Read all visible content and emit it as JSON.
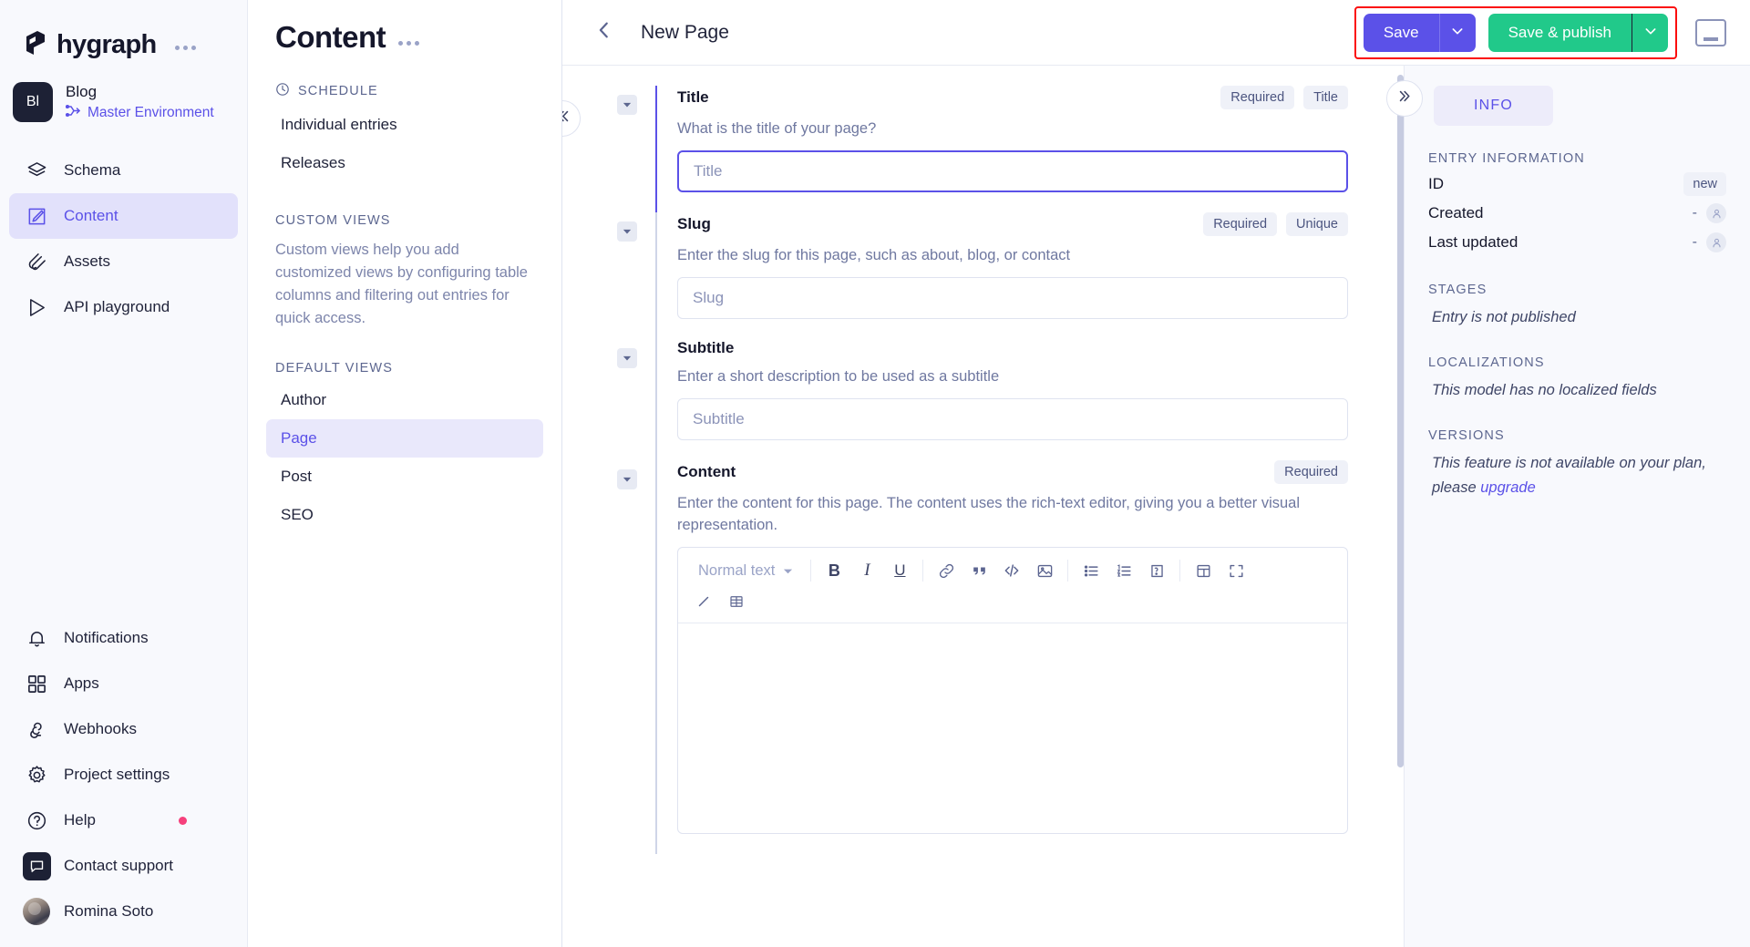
{
  "brand": {
    "name": "hygraph",
    "menu_icon": "more-horizontal-icon"
  },
  "project": {
    "avatar_initials": "Bl",
    "name": "Blog",
    "environment": "Master Environment",
    "environment_icon": "branch-icon"
  },
  "sidebar": {
    "items": [
      {
        "label": "Schema",
        "icon": "layers-icon",
        "active": false
      },
      {
        "label": "Content",
        "icon": "edit-square-icon",
        "active": true
      },
      {
        "label": "Assets",
        "icon": "paperclip-icon",
        "active": false
      },
      {
        "label": "API playground",
        "icon": "play-icon",
        "active": false
      }
    ],
    "bottom_items": [
      {
        "label": "Notifications",
        "icon": "bell-icon",
        "badge": false
      },
      {
        "label": "Apps",
        "icon": "grid-icon",
        "badge": false
      },
      {
        "label": "Webhooks",
        "icon": "webhook-icon",
        "badge": false
      },
      {
        "label": "Project settings",
        "icon": "gear-icon",
        "badge": false
      },
      {
        "label": "Help",
        "icon": "question-circle-icon",
        "badge": true
      },
      {
        "label": "Contact support",
        "icon": "chat-icon",
        "badge": false
      },
      {
        "label": "Romina Soto",
        "icon": "avatar",
        "badge": false
      }
    ]
  },
  "content_pane": {
    "title": "Content",
    "menu_icon": "more-horizontal-icon",
    "schedule": {
      "heading": "SCHEDULE",
      "icon": "clock-icon",
      "items": [
        {
          "label": "Individual entries",
          "active": false
        },
        {
          "label": "Releases",
          "active": false
        }
      ]
    },
    "custom_views": {
      "heading": "CUSTOM VIEWS",
      "description": "Custom views help you add customized views by configuring table columns and filtering out entries for quick access."
    },
    "default_views": {
      "heading": "DEFAULT VIEWS",
      "items": [
        {
          "label": "Author",
          "active": false
        },
        {
          "label": "Page",
          "active": true
        },
        {
          "label": "Post",
          "active": false
        },
        {
          "label": "SEO",
          "active": false
        }
      ]
    }
  },
  "topbar": {
    "back_icon": "chevron-left-icon",
    "title": "New Page",
    "save_label": "Save",
    "save_caret_icon": "chevron-down-icon",
    "publish_label": "Save & publish",
    "publish_caret_icon": "chevron-down-icon",
    "panel_toggle_icon": "panel-bottom-icon",
    "highlight_color": "#fb0d0d",
    "save_color": "#5b51e8",
    "publish_color": "#21c98a"
  },
  "editor": {
    "collapse_left_icon": "chevrons-left-icon",
    "fields": [
      {
        "label": "Title",
        "description": "What is the title of your page?",
        "chips": [
          "Required",
          "Title"
        ],
        "placeholder": "Title",
        "value": "",
        "focused": true
      },
      {
        "label": "Slug",
        "description": "Enter the slug for this page, such as about, blog, or contact",
        "chips": [
          "Required",
          "Unique"
        ],
        "placeholder": "Slug",
        "value": "",
        "focused": false
      },
      {
        "label": "Subtitle",
        "description": "Enter a short description to be used as a subtitle",
        "chips": [],
        "placeholder": "Subtitle",
        "value": "",
        "focused": false
      }
    ],
    "rich_field": {
      "label": "Content",
      "description": "Enter the content for this page. The content uses the rich-text editor, giving you a better visual representation.",
      "chips": [
        "Required"
      ],
      "toolbar": {
        "style_select": "Normal text",
        "style_caret_icon": "chevron-down-icon",
        "row1": [
          "bold-icon",
          "italic-icon",
          "underline-icon",
          "link-icon",
          "quote-icon",
          "code-icon",
          "image-icon",
          "bullet-list-icon",
          "numbered-list-icon",
          "embed-icon",
          "table-insert-icon",
          "fullscreen-icon"
        ],
        "row2": [
          "pen-icon",
          "table-icon"
        ]
      },
      "body_value": ""
    }
  },
  "info_panel": {
    "collapse_icon": "chevrons-right-icon",
    "tab_label": "INFO",
    "entry_information": {
      "heading": "ENTRY INFORMATION",
      "rows": [
        {
          "label": "ID",
          "value": "new",
          "type": "badge"
        },
        {
          "label": "Created",
          "value": "-",
          "type": "user"
        },
        {
          "label": "Last updated",
          "value": "-",
          "type": "user"
        }
      ]
    },
    "stages": {
      "heading": "STAGES",
      "note": "Entry is not published"
    },
    "localizations": {
      "heading": "LOCALIZATIONS",
      "note": "This model has no localized fields"
    },
    "versions": {
      "heading": "VERSIONS",
      "note_prefix": "This feature is not available on your plan, please ",
      "note_link": "upgrade"
    }
  }
}
